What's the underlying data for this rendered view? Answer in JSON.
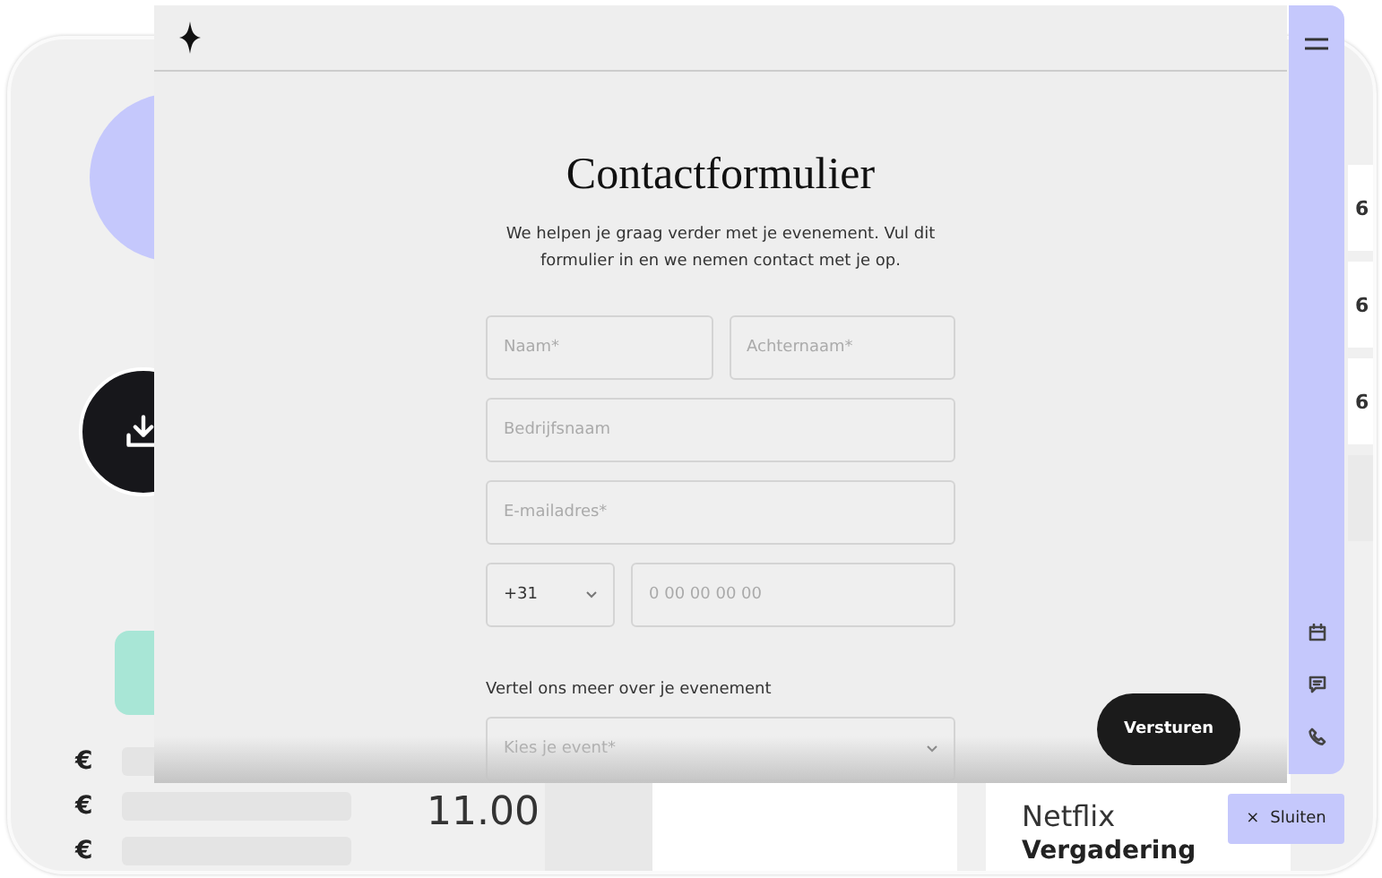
{
  "background": {
    "price_rows": [
      {
        "currency": "€"
      },
      {
        "currency": "€"
      },
      {
        "currency": "€"
      }
    ],
    "time": "11.00",
    "column_cells": [
      "6",
      "6",
      "6"
    ],
    "event": {
      "title": "Netflix",
      "subtitle": "Vergadering"
    },
    "close_button": {
      "icon": "×",
      "label": "Sluiten"
    }
  },
  "contact_form": {
    "title": "Contactformulier",
    "intro": "We helpen je graag verder met je evenement. Vul dit formulier in en we nemen contact met je op.",
    "field_rows": [
      {
        "fields": [
          {
            "placeholder": "Naam*"
          },
          {
            "placeholder": "Achternaam*"
          }
        ]
      },
      {
        "fields": [
          {
            "placeholder": "Bedrijfsnaam"
          }
        ]
      },
      {
        "fields": [
          {
            "placeholder": "E-mailadres*"
          }
        ]
      }
    ],
    "phone": {
      "country_code": "+31",
      "placeholder": "0 00 00 00 00"
    },
    "event_label": "Vertel ons meer over je evenement",
    "event_select": {
      "placeholder": "Kies je event*"
    },
    "submit": "Versturen"
  }
}
